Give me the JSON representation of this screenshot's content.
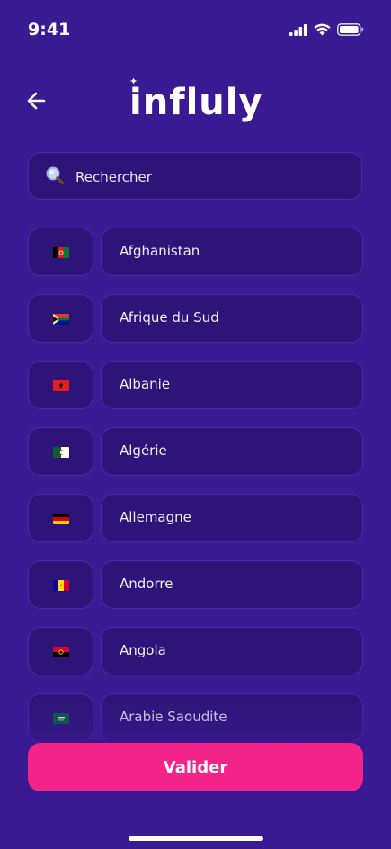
{
  "status_bar": {
    "time": "9:41"
  },
  "header": {
    "logo_text": "influly",
    "back_icon": "arrow-left-icon"
  },
  "search": {
    "placeholder": "Rechercher",
    "icon": "search-icon"
  },
  "countries": [
    {
      "name": "Afghanistan",
      "flag": "AF"
    },
    {
      "name": "Afrique du Sud",
      "flag": "ZA"
    },
    {
      "name": "Albanie",
      "flag": "AL"
    },
    {
      "name": "Algérie",
      "flag": "DZ"
    },
    {
      "name": "Allemagne",
      "flag": "DE"
    },
    {
      "name": "Andorre",
      "flag": "AD"
    },
    {
      "name": "Angola",
      "flag": "AO"
    },
    {
      "name": "Arabie Saoudite",
      "flag": "SA"
    }
  ],
  "footer": {
    "submit_label": "Valider"
  },
  "colors": {
    "background": "#3a1a92",
    "card": "#2e1478",
    "accent": "#f42389"
  }
}
